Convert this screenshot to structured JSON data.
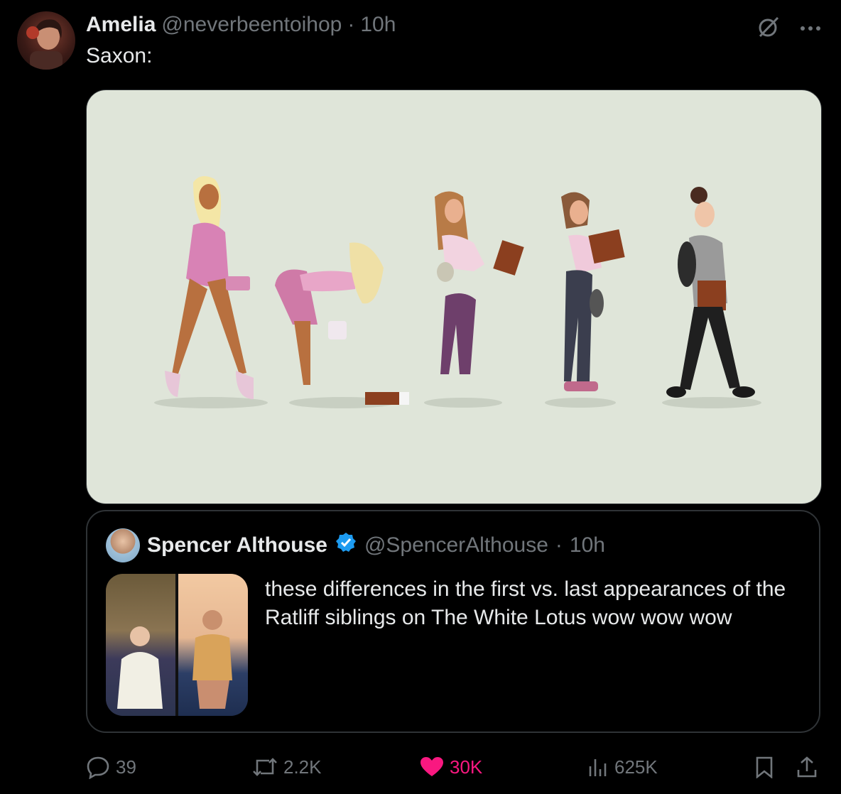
{
  "tweet": {
    "author_name": "Amelia",
    "author_handle": "@neverbeentoihop",
    "separator": "·",
    "time": "10h",
    "text": "Saxon:"
  },
  "quoted": {
    "author_name": "Spencer Althouse",
    "author_handle": "@SpencerAlthouse",
    "separator": "·",
    "time": "10h",
    "text": "these differences in the first vs. last appearances of the Ratliff siblings on The White Lotus wow wow wow"
  },
  "actions": {
    "replies": "39",
    "reposts": "2.2K",
    "likes": "30K",
    "views": "625K"
  },
  "icons": {
    "grok": "grok-icon",
    "more": "more-icon",
    "reply": "reply-icon",
    "repost": "repost-icon",
    "like": "heart-icon",
    "views": "views-icon",
    "bookmark": "bookmark-icon",
    "share": "share-icon",
    "verified": "verified-badge-icon"
  },
  "colors": {
    "background": "#000000",
    "text": "#e7e9ea",
    "muted": "#71767b",
    "like": "#f91880",
    "verified": "#1d9bf0",
    "media_bg": "#dfe5d9"
  }
}
